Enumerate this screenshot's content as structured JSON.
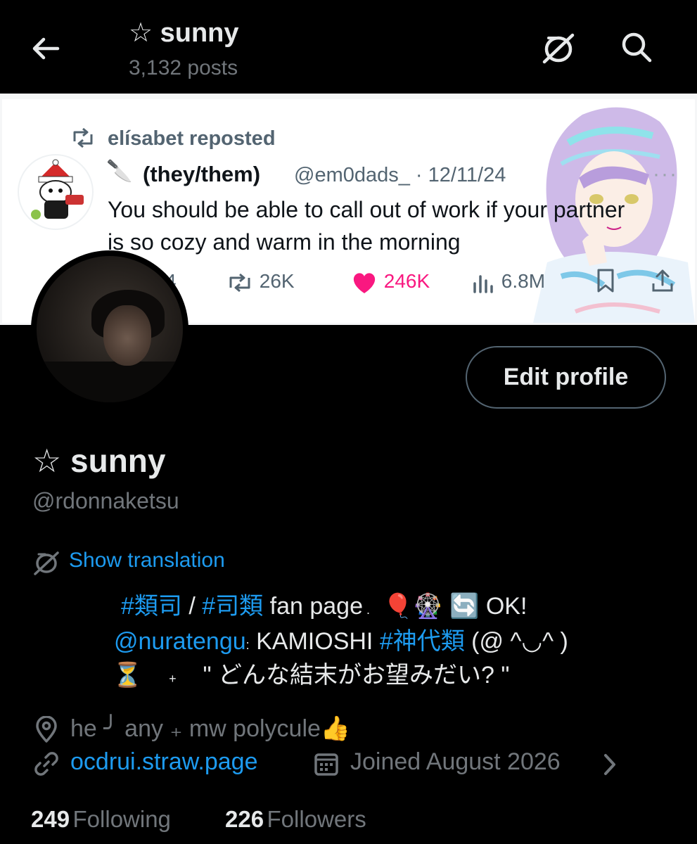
{
  "header": {
    "title": "☆ sunny",
    "posts_count": "3,132 posts",
    "back_icon": "arrow-left-icon",
    "translate_icon": "translate-icon",
    "search_icon": "search-icon"
  },
  "banner": {
    "reposted_by": "elísabet reposted",
    "author_emoji": "🔪",
    "author_name": "(they/them)",
    "author_meta": "@em0dads_ · 12/11/24",
    "more": "···",
    "text": "You should be able to call out of work if your partner is so cozy and warm in the morning",
    "metrics": {
      "replies": "4",
      "reposts": "26K",
      "likes": "246K",
      "views": "6.8M"
    }
  },
  "profile": {
    "edit_button": "Edit profile",
    "display_name": "☆ sunny",
    "username": "@rdonnaketsu",
    "show_translation": "Show translation",
    "bio": {
      "line1_tag1": "#類司",
      "line1_sep": " / ",
      "line1_tag2": "#司類",
      "line1_text": " fan page",
      "line1_dot": " .",
      "line1_emoji1": "🎈",
      "line1_emoji2": "🎡",
      "line1_emoji3": "🔄",
      "line1_end": " OK!",
      "line2_mention": "@nuratengu",
      "line2_colon": ":",
      "line2_text": " KAMIOSHI ",
      "line2_tag": "#神代類",
      "line2_kaomoji": " (@ ^◡^ )",
      "line3_emoji": "⏳",
      "line3_plus": "+",
      "line3_text": "\"  どんな結末がお望みだい?  \""
    },
    "location": "he ╯ any  ₊  mw polycule👍",
    "website": "ocdrui.straw.page",
    "joined": "Joined August 2026",
    "following_count": "249",
    "following_label": "Following",
    "followers_count": "226",
    "followers_label": "Followers"
  },
  "colors": {
    "background": "#000000",
    "accent": "#1d9bf0",
    "muted": "#71767b",
    "like": "#f91880"
  }
}
